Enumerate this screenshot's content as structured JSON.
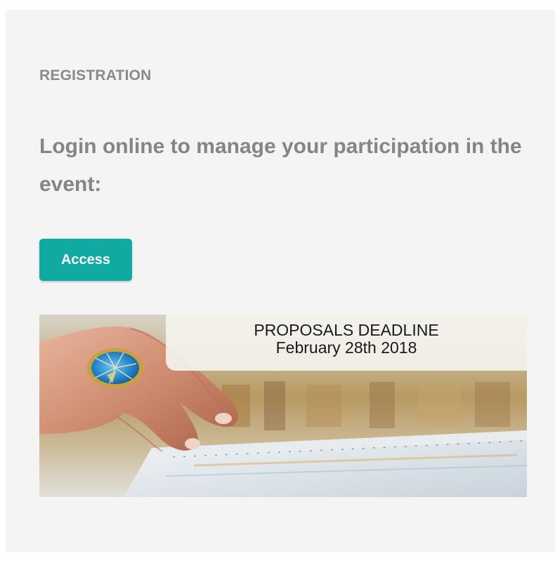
{
  "registration": {
    "section_label": "REGISTRATION",
    "headline": "Login online to manage your participation in the event:",
    "access_button": "Access"
  },
  "banner": {
    "caption_line1": "PROPOSALS DEADLINE",
    "caption_line2": "February 28th 2018"
  },
  "colors": {
    "panel_background": "#f4f4f4",
    "text_gray": "#858585",
    "accent_teal": "#10aaa3"
  }
}
